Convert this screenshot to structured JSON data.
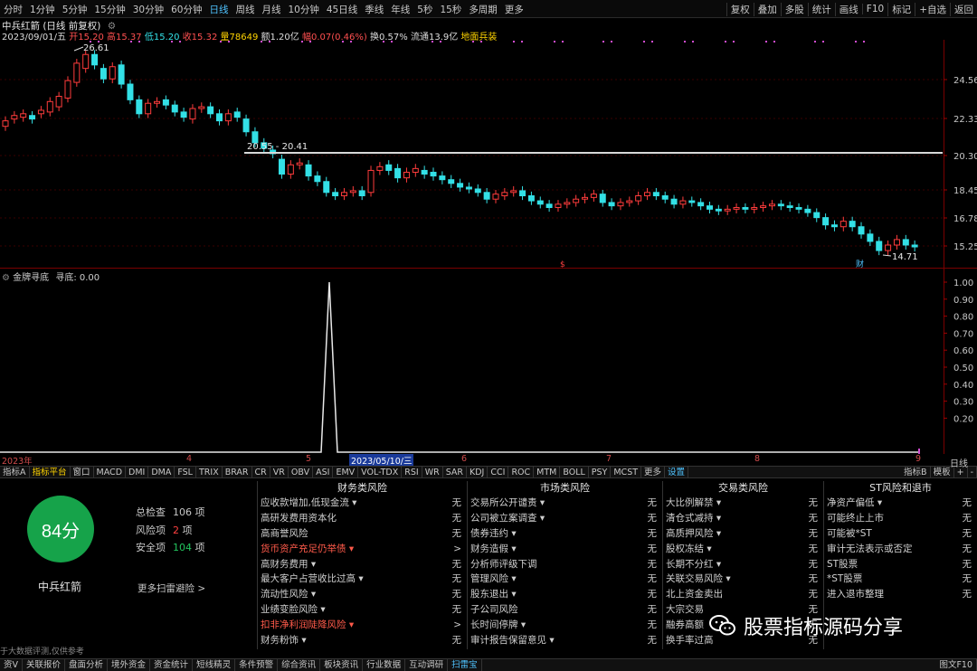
{
  "toolbar": {
    "timeframes": [
      "分时",
      "1分钟",
      "5分钟",
      "15分钟",
      "30分钟",
      "60分钟",
      "日线",
      "周线",
      "月线",
      "10分钟",
      "45日线",
      "季线",
      "年线",
      "5秒",
      "15秒",
      "多周期",
      "更多"
    ],
    "active_timeframe": "日线",
    "right_buttons": [
      "复权",
      "叠加",
      "多股",
      "统计",
      "画线",
      "F10",
      "标记",
      "+自选",
      "返回"
    ]
  },
  "stock": {
    "title": "中兵红箭 (日线 前复权)",
    "date": "2023/09/01/五",
    "open": "开15.20",
    "high": "高15.37",
    "low": "低15.20",
    "close": "收15.32",
    "volume": "量78649",
    "amount": "额1.20亿",
    "change": "幅0.07(0.46%)",
    "turnover": "换0.57%",
    "float_cap": "流通13.9亿",
    "sector": "地面兵装"
  },
  "main_chart": {
    "y_labels": [
      "24.56",
      "22.33",
      "20.30",
      "18.45",
      "16.78",
      "15.25"
    ],
    "high_mark": "26.61",
    "low_mark": "14.71",
    "range_label": "20.55 - 20.41",
    "markers": [
      "$",
      "财"
    ]
  },
  "indicator": {
    "title": "金牌寻底",
    "subtitle": "寻底: 0.00",
    "y_labels": [
      "1.00",
      "0.90",
      "0.80",
      "0.70",
      "0.60",
      "0.50",
      "0.40",
      "0.30",
      "0.20"
    ],
    "x_labels": [
      "2023年",
      "4",
      "5",
      "2023/05/10/三",
      "6",
      "7",
      "8",
      "9"
    ],
    "corner_label": "日线"
  },
  "chart_data": {
    "type": "line",
    "title": "金牌寻底",
    "x": [
      "2023年",
      "4",
      "5",
      "2023/05/10/三",
      "6",
      "7",
      "8",
      "9"
    ],
    "series": [
      {
        "name": "寻底",
        "values": [
          0,
          0,
          0,
          1.0,
          0,
          0,
          0,
          0
        ]
      }
    ],
    "ylim": [
      0,
      1.0
    ]
  },
  "tabs": [
    "指标A",
    "指标平台",
    "窗口",
    "MACD",
    "DMI",
    "DMA",
    "FSL",
    "TRIX",
    "BRAR",
    "CR",
    "VR",
    "OBV",
    "ASI",
    "EMV",
    "VOL-TDX",
    "RSI",
    "WR",
    "SAR",
    "KDJ",
    "CCI",
    "ROC",
    "MTM",
    "BOLL",
    "PSY",
    "MCST",
    "更多",
    "设置"
  ],
  "tabs_right": [
    "指标B",
    "模板",
    "+",
    "-"
  ],
  "scan": {
    "score": "84分",
    "stock_name": "中兵红箭",
    "total_label": "总检查",
    "total_value": "106",
    "total_unit": "项",
    "risk_label": "风险项",
    "risk_value": "2",
    "risk_unit": "项",
    "safe_label": "安全项",
    "safe_value": "104",
    "safe_unit": "项",
    "more_link": "更多扫雷避险 >",
    "footnote": "于大数据评测,仅供参考",
    "columns": [
      {
        "title": "财务类风险",
        "items": [
          {
            "label": "应收款增加,低现金流 ▾",
            "value": "无",
            "risk": false
          },
          {
            "label": "高研发费用资本化",
            "value": "无",
            "risk": false
          },
          {
            "label": "高商誉风险",
            "value": "无",
            "risk": false
          },
          {
            "label": "货币资产充足仍举债 ▾",
            "value": ">",
            "risk": true
          },
          {
            "label": "高财务费用 ▾",
            "value": "无",
            "risk": false
          },
          {
            "label": "最大客户占营收比过高 ▾",
            "value": "无",
            "risk": false
          },
          {
            "label": "流动性风险 ▾",
            "value": "无",
            "risk": false
          },
          {
            "label": "业绩变脸风险 ▾",
            "value": "无",
            "risk": false
          },
          {
            "label": "扣非净利润陡降风险 ▾",
            "value": ">",
            "risk": true
          },
          {
            "label": "财务粉饰 ▾",
            "value": "无",
            "risk": false
          }
        ]
      },
      {
        "title": "市场类风险",
        "items": [
          {
            "label": "交易所公开谴责 ▾",
            "value": "无",
            "risk": false
          },
          {
            "label": "公司被立案调查 ▾",
            "value": "无",
            "risk": false
          },
          {
            "label": "债券违约 ▾",
            "value": "无",
            "risk": false
          },
          {
            "label": "财务造假 ▾",
            "value": "无",
            "risk": false
          },
          {
            "label": "分析师评级下调",
            "value": "无",
            "risk": false
          },
          {
            "label": "管理风险 ▾",
            "value": "无",
            "risk": false
          },
          {
            "label": "股东退出 ▾",
            "value": "无",
            "risk": false
          },
          {
            "label": "子公司风险",
            "value": "无",
            "risk": false
          },
          {
            "label": "长时间停牌 ▾",
            "value": "无",
            "risk": false
          },
          {
            "label": "审计报告保留意见 ▾",
            "value": "无",
            "risk": false
          }
        ]
      },
      {
        "title": "交易类风险",
        "items": [
          {
            "label": "大比例解禁 ▾",
            "value": "无",
            "risk": false
          },
          {
            "label": "清仓式减持 ▾",
            "value": "无",
            "risk": false
          },
          {
            "label": "高质押风险 ▾",
            "value": "无",
            "risk": false
          },
          {
            "label": "股权冻结 ▾",
            "value": "无",
            "risk": false
          },
          {
            "label": "长期不分红 ▾",
            "value": "无",
            "risk": false
          },
          {
            "label": "关联交易风险 ▾",
            "value": "无",
            "risk": false
          },
          {
            "label": "北上资金卖出",
            "value": "无",
            "risk": false
          },
          {
            "label": "大宗交易",
            "value": "无",
            "risk": false
          },
          {
            "label": "融券高额",
            "value": "无",
            "risk": false
          },
          {
            "label": "换手率过高",
            "value": "无",
            "risk": false
          }
        ]
      },
      {
        "title": "ST风险和退市",
        "items": [
          {
            "label": "净资产偏低 ▾",
            "value": "无",
            "risk": false
          },
          {
            "label": "可能终止上市",
            "value": "无",
            "risk": false
          },
          {
            "label": "可能被*ST",
            "value": "无",
            "risk": false
          },
          {
            "label": "审计无法表示或否定",
            "value": "无",
            "risk": false
          },
          {
            "label": "ST股票",
            "value": "无",
            "risk": false
          },
          {
            "label": "*ST股票",
            "value": "无",
            "risk": false
          },
          {
            "label": "进入退市整理",
            "value": "无",
            "risk": false
          }
        ]
      }
    ]
  },
  "watermark": "股票指标源码分享",
  "status_bar": [
    "资V",
    "关联报价",
    "盘面分析",
    "境外资金",
    "资金统计",
    "短线精灵",
    "条件预警",
    "综合资讯",
    "板块资讯",
    "行业数据",
    "互动调研",
    "扫雷宝"
  ],
  "status_active": "扫雷宝",
  "status_right": "图文F10",
  "colors": {
    "up": "#ff3c3c",
    "down": "#33e0e6",
    "accent": "#4fc3ff",
    "score": "#16a34a",
    "risk": "#ff5a4a"
  }
}
